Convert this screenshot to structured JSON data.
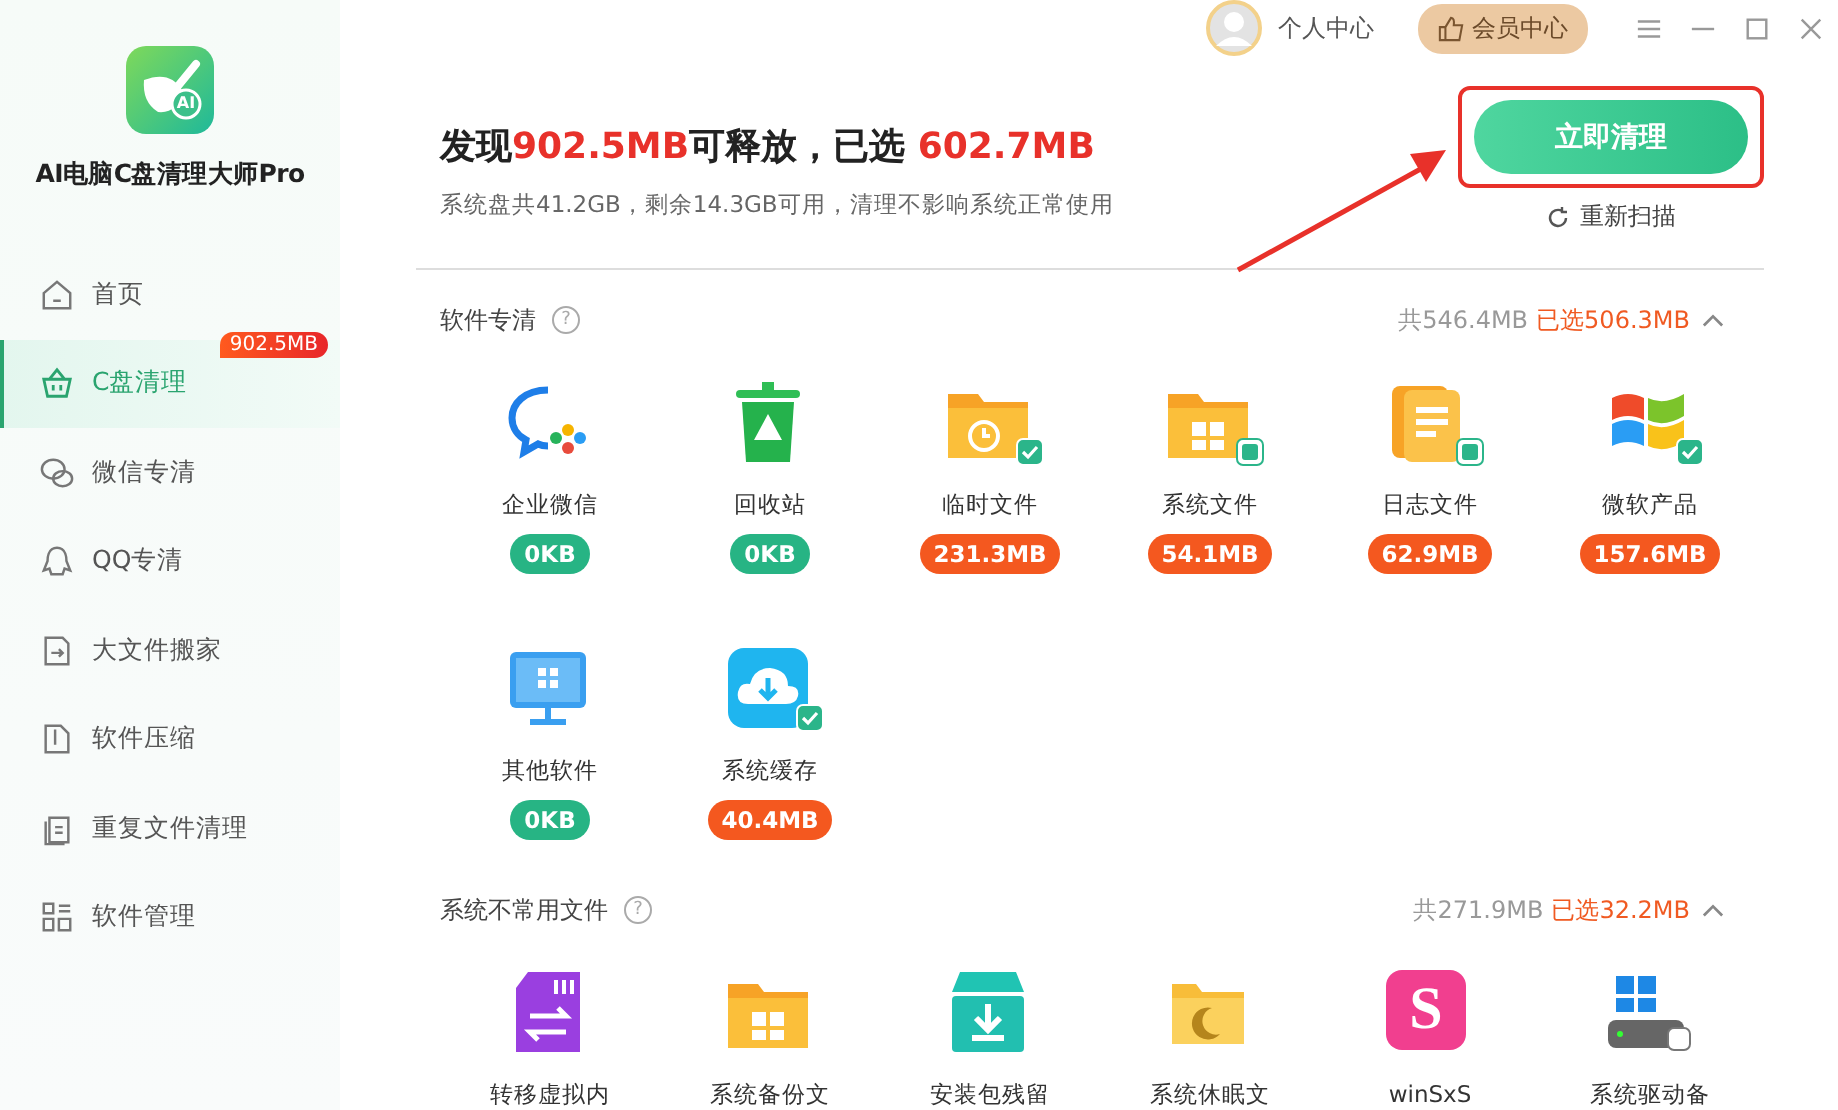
{
  "app": {
    "name": "AI电脑C盘清理大师Pro",
    "logo_text": "AI"
  },
  "sidebar": {
    "items": [
      {
        "label": "首页",
        "selected": false
      },
      {
        "label": "C盘清理",
        "selected": true,
        "badge": "902.5MB"
      },
      {
        "label": "微信专清",
        "selected": false
      },
      {
        "label": "QQ专清",
        "selected": false
      },
      {
        "label": "大文件搬家",
        "selected": false
      },
      {
        "label": "软件压缩",
        "selected": false
      },
      {
        "label": "重复文件清理",
        "selected": false
      },
      {
        "label": "软件管理",
        "selected": false
      }
    ]
  },
  "topbar": {
    "user": "个人中心",
    "vip": "会员中心"
  },
  "summary": {
    "headline": [
      {
        "text": "发现",
        "accent": false
      },
      {
        "text": "902.5MB",
        "accent": true
      },
      {
        "text": "可释放，已选 ",
        "accent": false
      },
      {
        "text": "602.7MB",
        "accent": true
      }
    ],
    "subtitle": "系统盘共41.2GB，剩余14.3GB可用，清理不影响系统正常使用",
    "clean_button": "立即清理",
    "rescan": "重新扫描"
  },
  "sections": [
    {
      "title": "软件专清",
      "help": "?",
      "total": "共546.4MB",
      "chosen": "已选506.3MB",
      "expanded": true,
      "items": [
        {
          "label": "企业微信",
          "size": "0KB",
          "checked": false,
          "indeterminate": false
        },
        {
          "label": "回收站",
          "size": "0KB",
          "checked": false,
          "indeterminate": false
        },
        {
          "label": "临时文件",
          "size": "231.3MB",
          "checked": true,
          "indeterminate": false
        },
        {
          "label": "系统文件",
          "size": "54.1MB",
          "checked": false,
          "indeterminate": true
        },
        {
          "label": "日志文件",
          "size": "62.9MB",
          "checked": false,
          "indeterminate": true
        },
        {
          "label": "微软产品",
          "size": "157.6MB",
          "checked": true,
          "indeterminate": false
        },
        {
          "label": "其他软件",
          "size": "0KB",
          "checked": false,
          "indeterminate": false
        },
        {
          "label": "系统缓存",
          "size": "40.4MB",
          "checked": true,
          "indeterminate": false
        }
      ]
    },
    {
      "title": "系统不常用文件",
      "help": "?",
      "total": "共271.9MB",
      "chosen": "已选32.2MB",
      "expanded": true,
      "items": [
        {
          "label": "转移虚拟内"
        },
        {
          "label": "系统备份文"
        },
        {
          "label": "安装包残留"
        },
        {
          "label": "系统休眠文"
        },
        {
          "label": "winSxS",
          "glyph": "S"
        },
        {
          "label": "系统驱动备"
        }
      ]
    }
  ]
}
